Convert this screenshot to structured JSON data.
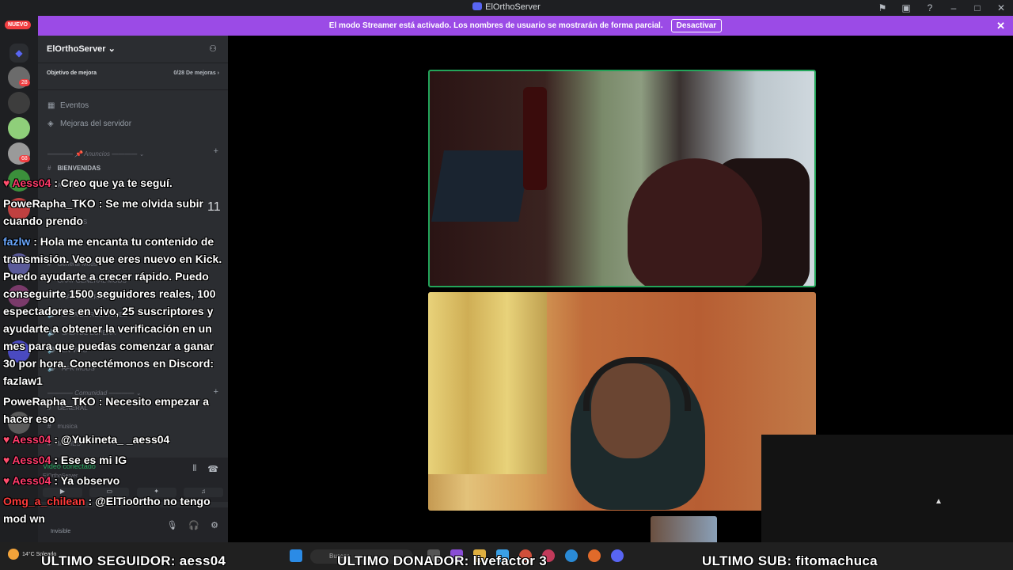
{
  "window": {
    "title": "ElOrthoServer"
  },
  "banner": {
    "text": "El modo Streamer está activado. Los nombres de usuario se mostrarán de forma parcial.",
    "button": "Desactivar"
  },
  "rail": {
    "new_badge": "NUEVO",
    "counts": [
      "28",
      "68"
    ]
  },
  "sidebar": {
    "server_name": "ElOrthoServer",
    "boost_goal": "Objetivo de mejora",
    "boost_progress": "0/28 De mejoras",
    "items": [
      {
        "label": "Eventos"
      },
      {
        "label": "Mejoras del servidor"
      }
    ],
    "categories": [
      "Anuncios",
      "Comunidad"
    ],
    "channels": [
      "BIENVENIDAS",
      "AVISOS",
      "NOTICIAS",
      "General Mods",
      "CHAT GENERAL MODS",
      "CHAT GENERAL ADMINS",
      "SALA DE REUNIONES",
      "SALA DE ESPERA",
      "EN VIVO",
      "AFK MODS",
      "GENERAL",
      "musica",
      "MEMES"
    ],
    "unread": "11",
    "voice_status": "Video conectado",
    "user_status": "Invisible"
  },
  "chat": [
    {
      "heart": true,
      "user": "Aess04",
      "user_color": "#ff3b6b",
      "text": ": Creo que ya te seguí."
    },
    {
      "heart": false,
      "user": "PoweRapha_TKO",
      "user_color": "#ffffff",
      "text": ": Se me olvida subir cuando prendo"
    },
    {
      "heart": false,
      "user": "fazlw",
      "user_color": "#6aa8ff",
      "text": ": Hola me encanta tu contenido de transmisión. Veo que eres nuevo en Kick. Puedo ayudarte a crecer rápido. Puedo conseguirte 1500 seguidores reales, 100 espectadores en vivo, 25 suscriptores y ayudarte a obtener la verificación en un mes para que puedas comenzar a ganar 30 por hora. Conectémonos en Discord: fazlaw1"
    },
    {
      "heart": false,
      "user": "PoweRapha_TKO",
      "user_color": "#ffffff",
      "text": ": Necesito empezar a hacer eso"
    },
    {
      "heart": true,
      "user": "Aess04",
      "user_color": "#ff3b6b",
      "text": ": @Yukineta_ _aess04"
    },
    {
      "heart": true,
      "user": "Aess04",
      "user_color": "#ff3b6b",
      "text": ": Ese es mi IG"
    },
    {
      "heart": true,
      "user": "Aess04",
      "user_color": "#ff3b6b",
      "text": ": Ya observo"
    },
    {
      "heart": false,
      "user": "Omg_a_chilean",
      "user_color": "#ff3b3b",
      "text": ": @ElTio0rtho no tengo mod wn"
    }
  ],
  "taskbar": {
    "temperature": "14°C",
    "weather": "Soleado",
    "search_placeholder": "Buscar"
  },
  "overlay": {
    "follower": "ULTIMO SEGUIDOR: aess04",
    "donor": "ULTIMO DONADOR: livefactor   3",
    "sub": "ULTIMO SUB: fitomachuca"
  },
  "colors": {
    "banner": "#9b4be6",
    "speaking_border": "#23a55a"
  }
}
